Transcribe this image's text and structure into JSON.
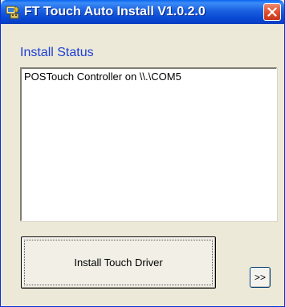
{
  "window": {
    "title": "FT Touch Auto Install V1.0.2.0",
    "icon": "app-icon",
    "close_icon": "close-icon"
  },
  "status": {
    "label": "Install Status",
    "lines": [
      "POSTouch Controller on \\\\.\\COM5"
    ]
  },
  "buttons": {
    "install_label": "Install Touch Driver",
    "more_label": ">>"
  },
  "colors": {
    "titlebar": "#0a46d1",
    "status_label": "#1c3fd6",
    "window_face": "#ece9d8",
    "close_button": "#dd4b2a"
  }
}
